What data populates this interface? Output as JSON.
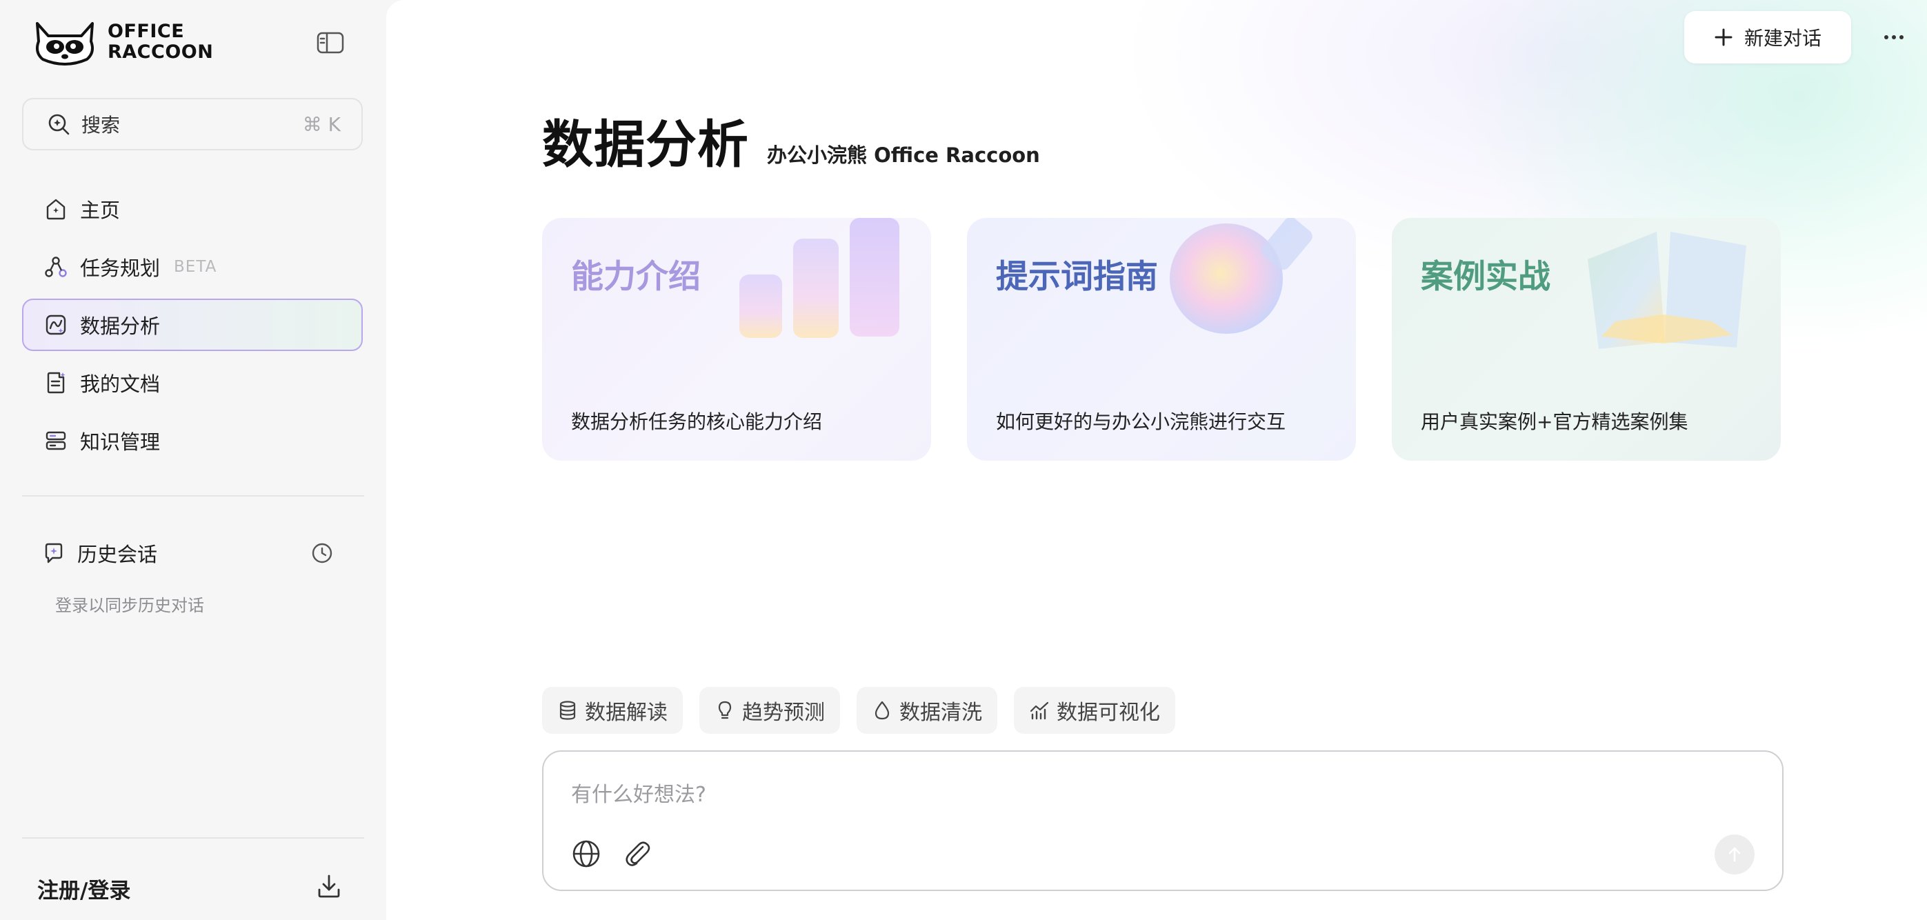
{
  "app": {
    "logo_line1": "OFFICE",
    "logo_line2": "RACCOON"
  },
  "sidebar": {
    "search_label": "搜索",
    "search_shortcut": "⌘ K",
    "items": [
      {
        "label": "主页",
        "icon": "home-icon"
      },
      {
        "label": "任务规划",
        "badge": "BETA",
        "icon": "task-plan-icon"
      },
      {
        "label": "数据分析",
        "icon": "data-analysis-icon",
        "active": true
      },
      {
        "label": "我的文档",
        "icon": "document-icon"
      },
      {
        "label": "知识管理",
        "icon": "knowledge-icon"
      }
    ],
    "history_label": "历史会话",
    "history_hint": "登录以同步历史对话",
    "login_label": "注册/登录"
  },
  "header": {
    "new_chat_label": "新建对话"
  },
  "main": {
    "title": "数据分析",
    "subtitle": "办公小浣熊 Office Raccoon",
    "cards": [
      {
        "title": "能力介绍",
        "desc": "数据分析任务的核心能力介绍",
        "title_color": "#a898e0"
      },
      {
        "title": "提示词指南",
        "desc": "如何更好的与办公小浣熊进行交互",
        "title_color": "#4c66b8"
      },
      {
        "title": "案例实战",
        "desc": "用户真实案例+官方精选案例集",
        "title_color": "#4f9c80"
      }
    ],
    "chips": [
      {
        "label": "数据解读",
        "icon": "database-icon"
      },
      {
        "label": "趋势预测",
        "icon": "lightbulb-icon"
      },
      {
        "label": "数据清洗",
        "icon": "droplet-icon"
      },
      {
        "label": "数据可视化",
        "icon": "chart-icon"
      }
    ],
    "composer": {
      "placeholder": "有什么好想法?"
    }
  },
  "colors": {
    "accent": "#b9a7ee",
    "sidebar_bg": "#f6f6f7"
  }
}
